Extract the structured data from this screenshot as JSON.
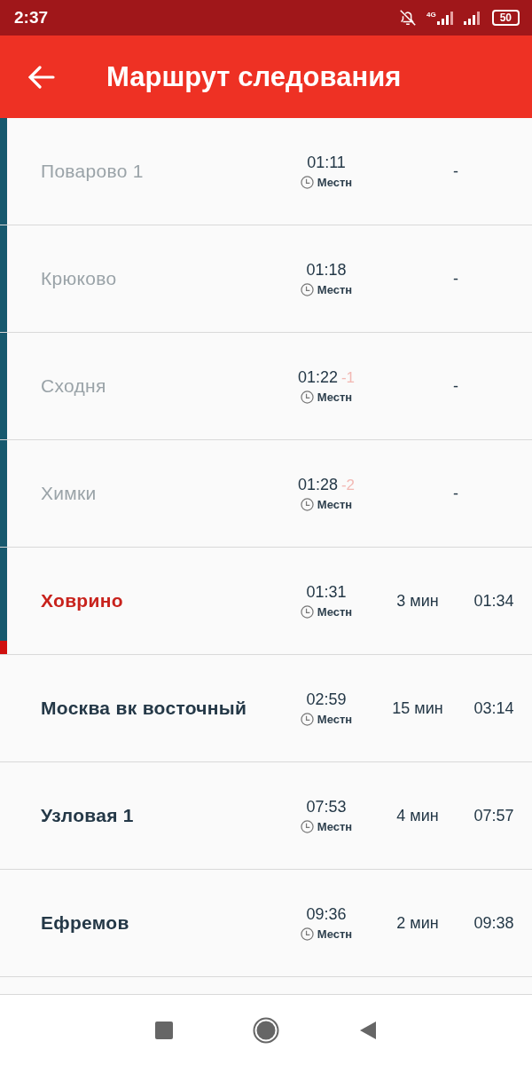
{
  "status_bar": {
    "time": "2:37",
    "network": "4G",
    "battery": "50"
  },
  "toolbar": {
    "title": "Маршрут следования"
  },
  "stops": [
    {
      "kind": "passed",
      "name": "Поварово 1",
      "time": "01:11",
      "clock": "Местн",
      "departure": "-"
    },
    {
      "kind": "passed",
      "name": "Крюково",
      "time": "01:18",
      "clock": "Местн",
      "departure": "-"
    },
    {
      "kind": "passed",
      "name": "Сходня",
      "time": "01:22",
      "delay": "-1",
      "clock": "Местн",
      "departure": "-"
    },
    {
      "kind": "passed",
      "name": "Химки",
      "time": "01:28",
      "delay": "-2",
      "clock": "Местн",
      "departure": "-"
    },
    {
      "kind": "current",
      "name": "Ховрино",
      "time": "01:31",
      "clock": "Местн",
      "stop": "3 мин",
      "departure": "01:34"
    },
    {
      "kind": "upcoming",
      "name": "Москва вк восточный",
      "time": "02:59",
      "clock": "Местн",
      "stop": "15 мин",
      "departure": "03:14"
    },
    {
      "kind": "upcoming",
      "name": "Узловая 1",
      "time": "07:53",
      "clock": "Местн",
      "stop": "4 мин",
      "departure": "07:57"
    },
    {
      "kind": "upcoming",
      "name": "Ефремов",
      "time": "09:36",
      "clock": "Местн",
      "stop": "2 мин",
      "departure": "09:38"
    }
  ]
}
